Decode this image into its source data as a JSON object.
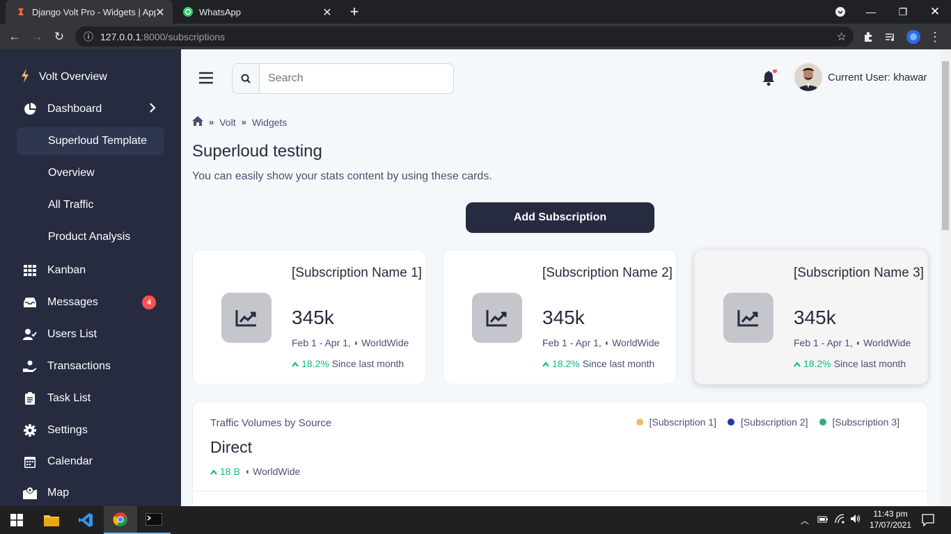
{
  "browser": {
    "tabs": [
      {
        "title": "Django Volt Pro - Widgets | AppS",
        "icon": "django-volt-icon",
        "active": true
      },
      {
        "title": "WhatsApp",
        "icon": "whatsapp-icon",
        "active": false
      }
    ],
    "url_host": "127.0.0.1",
    "url_rest": ":8000/subscriptions"
  },
  "sidebar": {
    "brand": "Volt Overview",
    "items": [
      {
        "label": "Dashboard",
        "icon": "pie-chart-icon"
      },
      {
        "label": "Superloud Template"
      },
      {
        "label": "Overview"
      },
      {
        "label": "All Traffic"
      },
      {
        "label": "Product Analysis"
      },
      {
        "label": "Kanban",
        "icon": "grid-icon"
      },
      {
        "label": "Messages",
        "icon": "inbox-icon",
        "badge": "4"
      },
      {
        "label": "Users List",
        "icon": "user-check-icon"
      },
      {
        "label": "Transactions",
        "icon": "hand-coin-icon"
      },
      {
        "label": "Task List",
        "icon": "clipboard-list-icon"
      },
      {
        "label": "Settings",
        "icon": "gear-icon"
      },
      {
        "label": "Calendar",
        "icon": "calendar-icon"
      },
      {
        "label": "Map",
        "icon": "map-pin-icon"
      }
    ]
  },
  "topbar": {
    "search_placeholder": "Search",
    "user_label": "Current User: khawar"
  },
  "breadcrumb": [
    "Volt",
    "Widgets"
  ],
  "page": {
    "title": "Superloud testing",
    "subtitle": "You can easily show your stats content by using these cards.",
    "add_button": "Add Subscription"
  },
  "cards": [
    {
      "name": "[Subscription Name 1]",
      "value": "345k",
      "date": "Feb 1 - Apr 1,",
      "region": "WorldWide",
      "delta": "18.2%",
      "delta_label": "Since last month"
    },
    {
      "name": "[Subscription Name 2]",
      "value": "345k",
      "date": "Feb 1 - Apr 1,",
      "region": "WorldWide",
      "delta": "18.2%",
      "delta_label": "Since last month"
    },
    {
      "name": "[Subscription Name 3]",
      "value": "345k",
      "date": "Feb 1 - Apr 1,",
      "region": "WorldWide",
      "delta": "18.2%",
      "delta_label": "Since last month"
    }
  ],
  "traffic": {
    "title": "Traffic Volumes by Source",
    "value": "Direct",
    "delta": "18 B",
    "region": "WorldWide",
    "legend": [
      {
        "label": "[Subscription 1]",
        "color": "#f0bc5e"
      },
      {
        "label": "[Subscription 2]",
        "color": "#1c3e9c"
      },
      {
        "label": "[Subscription 3]",
        "color": "#31a88d"
      }
    ]
  },
  "taskbar": {
    "time": "11:43 pm",
    "date": "17/07/2021"
  },
  "colors": {
    "sidebar": "#262b40",
    "accent_green": "#10b981",
    "badge_red": "#fa5252"
  }
}
